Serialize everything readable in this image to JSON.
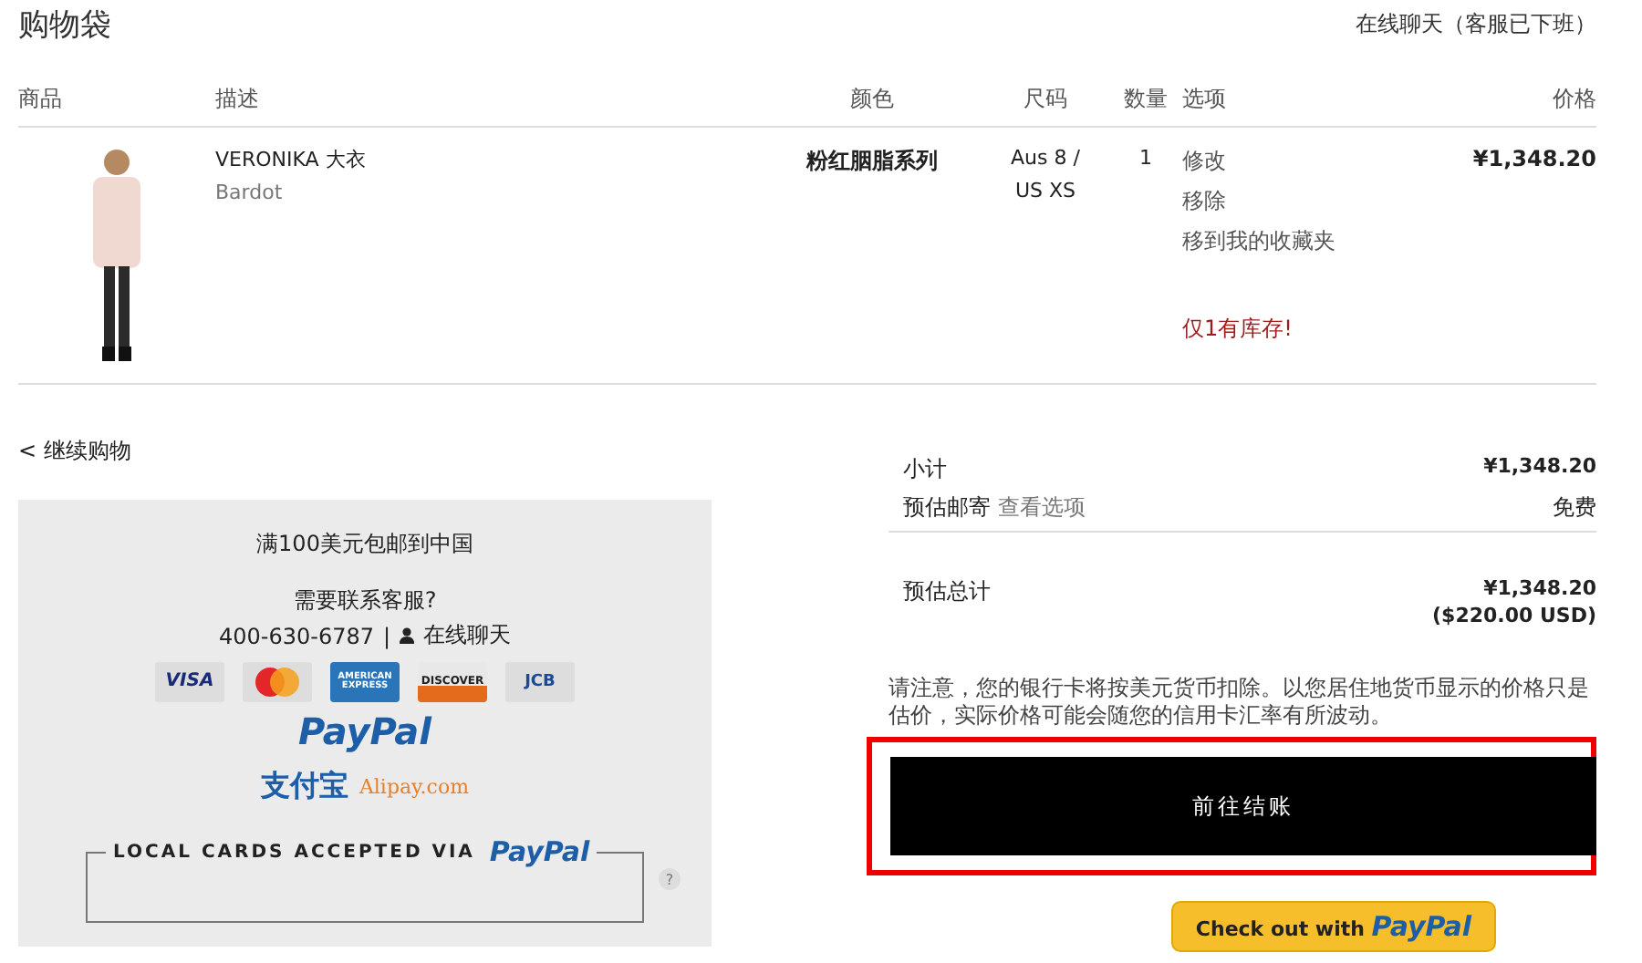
{
  "page_title": "购物袋",
  "chat_link": "在线聊天（客服已下班）",
  "table": {
    "columns": [
      "商品",
      "描述",
      "颜色",
      "尺码",
      "数量",
      "选项",
      "价格"
    ],
    "rows": [
      {
        "name": "VERONIKA 大衣",
        "brand": "Bardot",
        "color_name": "粉红胭脂系列",
        "size": [
          "Aus 8 /",
          "US XS"
        ],
        "quantity": "1",
        "options": [
          "修改",
          "移除",
          "移到我的收藏夹"
        ],
        "stock_note": "仅1有库存!",
        "price": "¥1,348.20"
      }
    ]
  },
  "continue_link": "< 继续购物",
  "info_panel": {
    "shipping_note": "满100美元包邮到中国",
    "help_title": "需要联系客服?",
    "phone": "400-630-6787",
    "separator": "|",
    "chat": "在线聊天",
    "cards": [
      {
        "kind": "visa",
        "label": "VISA"
      },
      {
        "kind": "mastercard"
      },
      {
        "kind": "amex",
        "label": "AMERICAN EXPRESS"
      },
      {
        "kind": "discover",
        "label": "DISCOVER"
      },
      {
        "kind": "jcb",
        "label": "JCB"
      }
    ],
    "paypal": "PayPal",
    "alipay_cn": "支付宝",
    "alipay_en": "Alipay.com",
    "local_cards": "LOCAL CARDS ACCEPTED VIA",
    "local_paypal": "PayPal",
    "help_mark": "?"
  },
  "summary": {
    "subtotal_label": "小计",
    "subtotal": "¥1,348.20",
    "shipping_label": "预估邮寄",
    "shipping_link": "查看选项",
    "shipping": "免费",
    "total_label": "预估总计",
    "total": "¥1,348.20",
    "total_usd": "($220.00 USD)",
    "notice": "请注意，您的银行卡将按美元货币扣除。以您居住地货币显示的价格只是估价，实际价格可能会随您的信用卡汇率有所波动。",
    "checkout": "前往结账",
    "paypal_checkout": "Check out with",
    "paypal_logo": "PayPal"
  }
}
